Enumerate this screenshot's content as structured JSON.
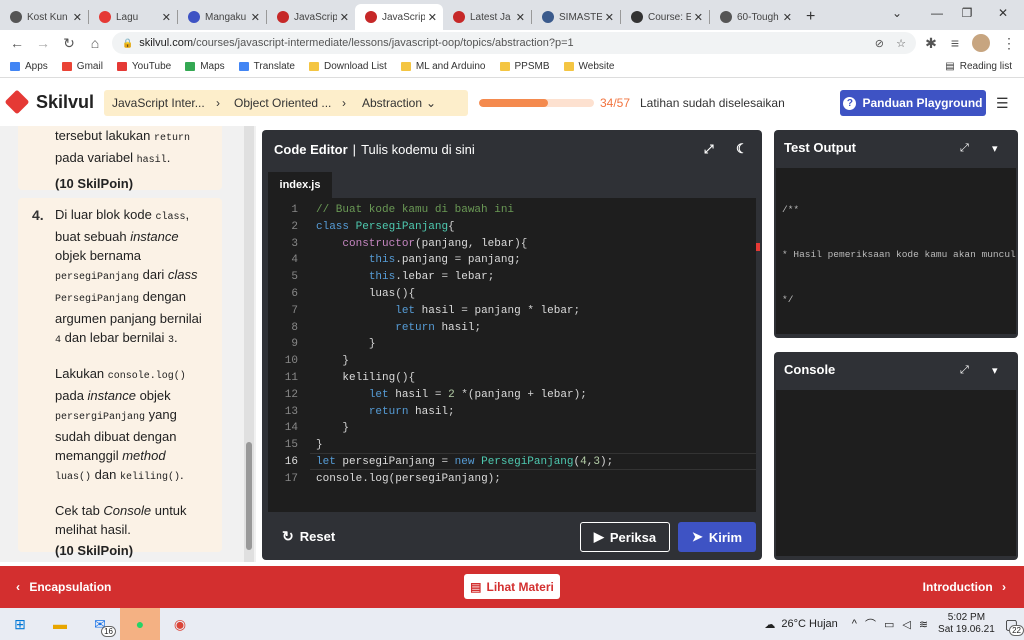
{
  "tabs": [
    {
      "title": "Kost Kun",
      "color": "#555"
    },
    {
      "title": "Lagu",
      "color": "#e53935"
    },
    {
      "title": "Mangaku",
      "color": "#3e53c4"
    },
    {
      "title": "JavaScrip",
      "color": "#c62828"
    },
    {
      "title": "JavaScrip",
      "color": "#c62828",
      "active": true
    },
    {
      "title": "Latest Ja",
      "color": "#c62828"
    },
    {
      "title": "SIMASTE",
      "color": "#3a5a8c"
    },
    {
      "title": "Course: E",
      "color": "#333"
    },
    {
      "title": "60-Tough",
      "color": "#555"
    }
  ],
  "address": {
    "domain": "skilvul.com",
    "path": "/courses/javascript-intermediate/lessons/javascript-oop/topics/abstraction?p=1"
  },
  "bookmarks": [
    {
      "label": "Apps",
      "color": "#4285f4"
    },
    {
      "label": "Gmail",
      "color": "#ea4335"
    },
    {
      "label": "YouTube",
      "color": "#e53935"
    },
    {
      "label": "Maps",
      "color": "#34a853"
    },
    {
      "label": "Translate",
      "color": "#4285f4"
    },
    {
      "label": "Download List",
      "color": "#f4c542"
    },
    {
      "label": "ML and Arduino",
      "color": "#f4c542"
    },
    {
      "label": "PPSMB",
      "color": "#f4c542"
    },
    {
      "label": "Website",
      "color": "#f4c542"
    }
  ],
  "reading_list": "Reading list",
  "brand": "Skilvul",
  "breadcrumbs": [
    "JavaScript Inter...",
    "Object Oriented ...",
    "Abstraction"
  ],
  "progress": {
    "label": "34/57",
    "fraction": 0.5965,
    "message": "Latihan sudah diselesaikan"
  },
  "guide_button": "Panduan Playground",
  "instructions": {
    "prev_tail": {
      "line1": "tersebut lakukan ",
      "code1": "return",
      "line2": "pada variabel ",
      "code2": "hasil",
      "line2b": ".",
      "points": "(10 SkilPoin)"
    },
    "step4": {
      "number": "4.",
      "p1": [
        "Di luar blok kode ",
        "class",
        ",",
        "buat sebuah ",
        "instance",
        "objek bernama",
        "persegiPanjang",
        " dari ",
        "class",
        "PersegiPanjang",
        " dengan",
        "argumen panjang bernilai",
        "4",
        " dan lebar bernilai ",
        "3",
        "."
      ],
      "p2": [
        "Lakukan ",
        "console.log()",
        "pada ",
        "instance",
        " objek",
        "persergiPanjang",
        " yang",
        "sudah dibuat dengan",
        "memanggil ",
        "method",
        "luas()",
        " dan ",
        "keliling()",
        "."
      ],
      "p3": [
        "Cek tab ",
        "Console",
        " untuk",
        "melihat hasil."
      ],
      "points": "(10 SkilPoin)"
    }
  },
  "editor": {
    "title": "Code Editor",
    "subtitle": "Tulis kodemu di sini",
    "file": "index.js",
    "current_line": 16,
    "lines": [
      "// Buat kode kamu di bawah ini",
      "class PersegiPanjang{",
      "    constructor(panjang, lebar){",
      "        this.panjang = panjang;",
      "        this.lebar = lebar;",
      "        luas(){",
      "            let hasil = panjang * lebar;",
      "            return hasil;",
      "        }",
      "    }",
      "    keliling(){",
      "        let hasil = 2 *(panjang + lebar);",
      "        return hasil;",
      "    }",
      "}",
      "let persegiPanjang = new PersegiPanjang(4,3);",
      "console.log(persegiPanjang);"
    ],
    "reset": "Reset",
    "check": "Periksa",
    "submit": "Kirim"
  },
  "test_output": {
    "title": "Test Output",
    "lines": [
      "/**",
      "* Hasil pemeriksaan kode kamu akan muncul",
      "*/"
    ]
  },
  "console": {
    "title": "Console"
  },
  "bottom_nav": {
    "prev": "Encapsulation",
    "material": "Lihat Materi",
    "next": "Introduction"
  },
  "taskbar": {
    "mail_badge": "16",
    "weather": "26°C  Hujan",
    "time": "5:02 PM",
    "date": "Sat 19.06.21",
    "notif": "22"
  }
}
